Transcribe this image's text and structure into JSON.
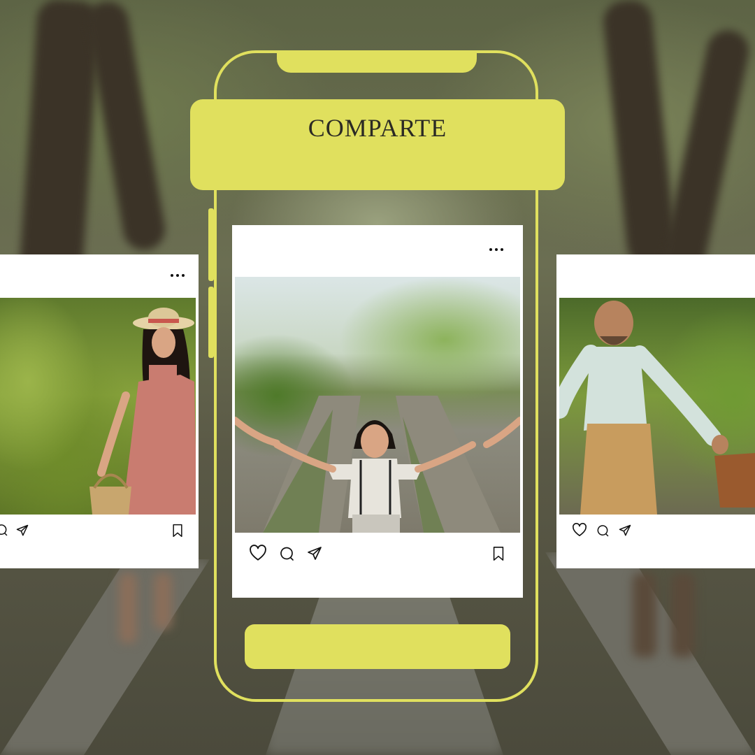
{
  "banner": {
    "title": "COMPARTE"
  },
  "colors": {
    "accent": "#e0e05e",
    "card": "#ffffff",
    "icon": "#111111"
  },
  "posts": [
    {
      "id": "left",
      "icons": [
        "comment-icon",
        "share-icon",
        "bookmark-icon"
      ],
      "menu_icon": "more-icon"
    },
    {
      "id": "center",
      "icons": [
        "heart-icon",
        "comment-icon",
        "share-icon",
        "bookmark-icon"
      ],
      "menu_icon": "more-icon"
    },
    {
      "id": "right",
      "icons": [
        "heart-icon",
        "comment-icon",
        "share-icon"
      ],
      "menu_icon": "more-icon"
    }
  ]
}
